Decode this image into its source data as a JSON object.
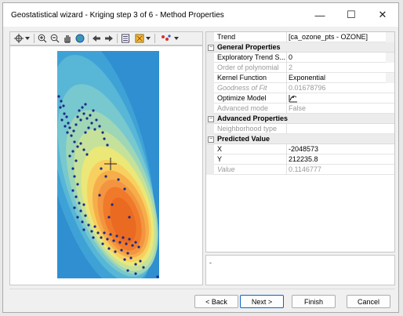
{
  "window": {
    "title": "Geostatistical wizard - Kriging step 3 of 6 - Method Properties",
    "minimize_glyph": "—",
    "maximize_glyph": "☐",
    "close_glyph": "✕"
  },
  "toolbar": {
    "icons": [
      "cross-select-icon",
      "zoom-in-icon",
      "zoom-out-icon",
      "pan-hand-icon",
      "globe-icon",
      "back-arrow-icon",
      "forward-arrow-icon",
      "layers-icon",
      "flag-icon",
      "color-dots-icon"
    ]
  },
  "properties": {
    "trend": {
      "name": "Trend",
      "value": "[ca_ozone_pts - OZONE]"
    },
    "general_header": "General Properties",
    "exploratory_trend": {
      "name": "Exploratory Trend S...",
      "value": "0"
    },
    "order_polynomial": {
      "name": "Order of polynomial",
      "value": "2"
    },
    "kernel_function": {
      "name": "Kernel Function",
      "value": "Exponential"
    },
    "goodness_fit": {
      "name": "Goodness of Fit",
      "value": "0.01678796"
    },
    "optimize_model": {
      "name": "Optimize Model",
      "value": ""
    },
    "advanced_mode": {
      "name": "Advanced mode",
      "value": "False"
    },
    "advanced_header": "Advanced Properties",
    "neighborhood_type": {
      "name": "Neighborhood type",
      "value": ""
    },
    "predicted_header": "Predicted Value",
    "x": {
      "name": "X",
      "value": "-2048573"
    },
    "y": {
      "name": "Y",
      "value": "212235.8"
    },
    "value": {
      "name": "Value",
      "value": "0.1146777"
    }
  },
  "description": "-",
  "buttons": {
    "back": "< Back",
    "next": "Next >",
    "finish": "Finish",
    "cancel": "Cancel"
  },
  "colors": {
    "accent": "#0a64c8",
    "map_low": "#2f8fd0",
    "map_high": "#f07a2a",
    "points": "#1a2a8a"
  }
}
